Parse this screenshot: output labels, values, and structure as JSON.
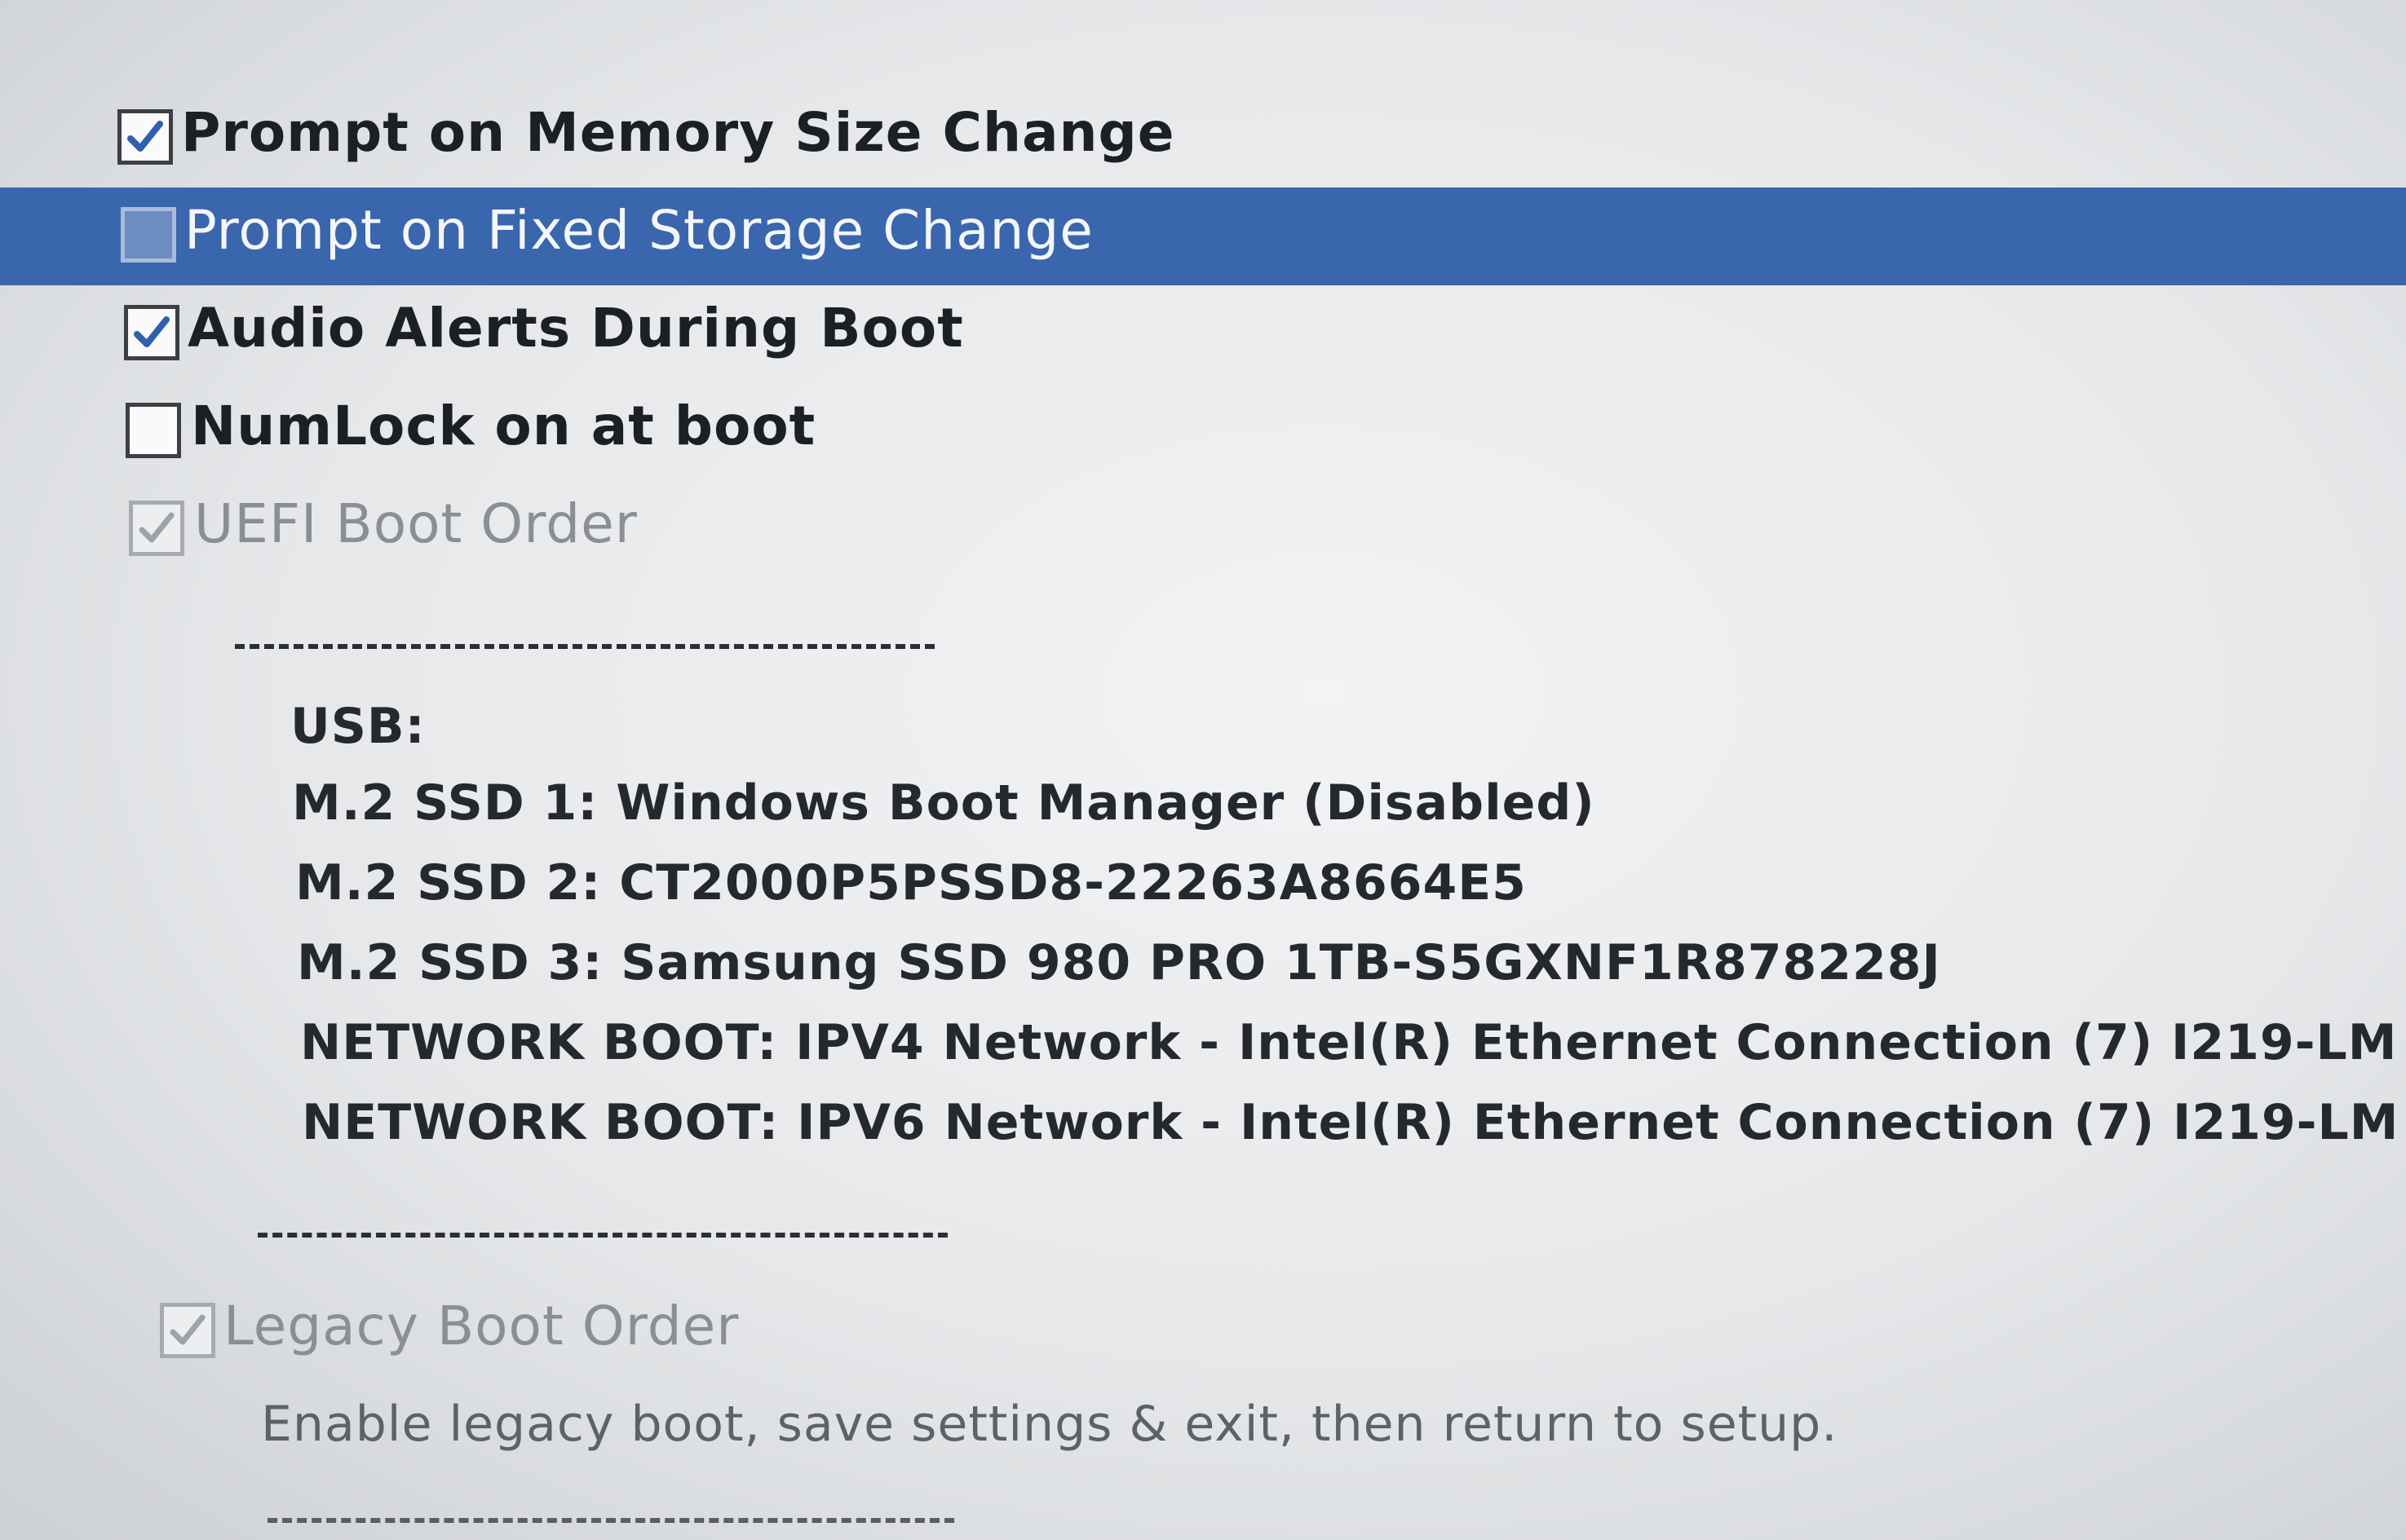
{
  "options": [
    {
      "label": "Prompt on Memory Size Change",
      "checked": true,
      "selected": false,
      "disabled": false
    },
    {
      "label": "Prompt on Fixed Storage Change",
      "checked": false,
      "selected": true,
      "disabled": false
    },
    {
      "label": "Audio Alerts During Boot",
      "checked": true,
      "selected": false,
      "disabled": false
    },
    {
      "label": "NumLock on at boot",
      "checked": false,
      "selected": false,
      "disabled": false
    },
    {
      "label": "UEFI Boot Order",
      "checked": true,
      "selected": false,
      "disabled": true
    }
  ],
  "uefi_boot_order": {
    "divider": "--------------------------",
    "entries": [
      "USB:",
      "M.2 SSD 1:  Windows Boot Manager  (Disabled)",
      "M.2 SSD 2:  CT2000P5PSSD8-22263A8664E5",
      "M.2 SSD 3:  Samsung SSD 980 PRO 1TB-S5GXNF1R878228J",
      "NETWORK BOOT:  IPV4 Network - Intel(R) Ethernet Connection (7) I219-LM",
      "NETWORK BOOT:  IPV6 Network - Intel(R) Ethernet Connection (7) I219-LM"
    ],
    "divider_end": "--------------------------"
  },
  "legacy_boot_order": {
    "label": "Legacy Boot Order",
    "checked": true,
    "disabled": true,
    "note": "Enable legacy boot, save settings & exit, then return to setup.",
    "divider": "--------------------------"
  },
  "colors": {
    "selection": "#3a66ad",
    "checkmark": "#2f5fae",
    "disabled_text": "#8b8f95"
  },
  "icons": {
    "checked": "checkmark-icon"
  }
}
